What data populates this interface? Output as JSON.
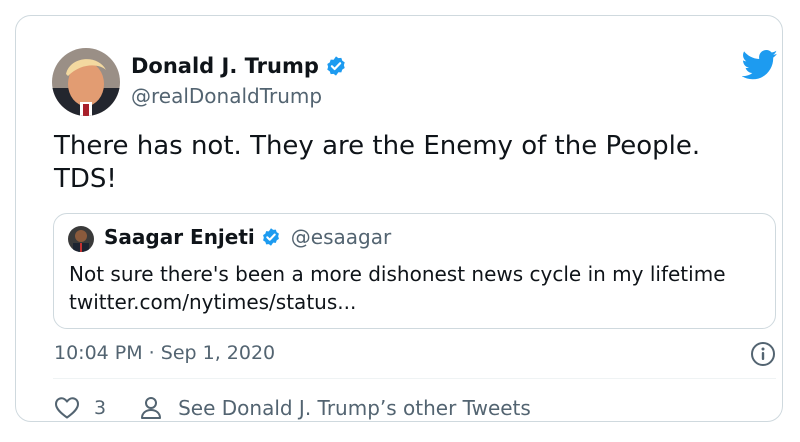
{
  "tweet": {
    "author_name": "Donald J. Trump",
    "author_handle": "@realDonaldTrump",
    "text_line1": "There has not. They are the Enemy of the People.",
    "text_line2": "TDS!",
    "timestamp": "10:04 PM · Sep 1, 2020",
    "like_count": "3",
    "other_tweets_label": "See Donald J. Trump’s other Tweets"
  },
  "quoted": {
    "author_name": "Saagar Enjeti",
    "author_handle": "@esaagar",
    "text_line1": "Not sure there's been a more dishonest news cycle in my lifetime",
    "text_line2": "twitter.com/nytimes/status..."
  },
  "icons": {
    "verified": "verified-badge-icon",
    "brand": "twitter-bird-icon",
    "info": "info-icon",
    "like": "heart-icon",
    "profile": "person-icon"
  },
  "colors": {
    "twitter_blue": "#1d9bf0",
    "secondary_text": "#536471",
    "border": "#cfd9de"
  }
}
